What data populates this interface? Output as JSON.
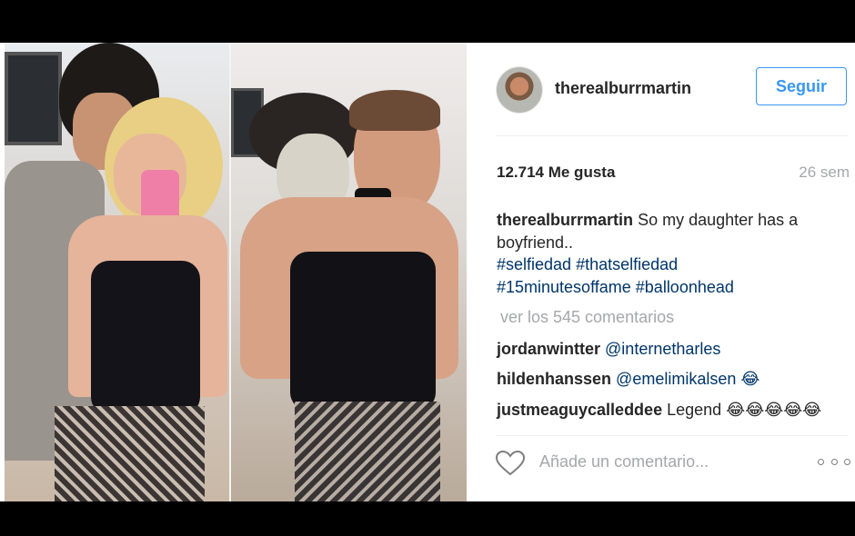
{
  "post": {
    "username": "therealburrmartin",
    "follow_label": "Seguir",
    "likes": "12.714 Me gusta",
    "time_ago": "26 sem",
    "caption": {
      "username": "therealburrmartin",
      "text": "So my daughter has a boyfriend..",
      "hashtags": [
        "#selfiedad",
        "#thatselfiedad",
        "#15minutesoffame",
        "#balloonhead"
      ]
    },
    "view_comments": "ver los 545 comentarios",
    "comments": [
      {
        "user": "jordanwintter",
        "text": "@internetharles",
        "is_mention": true
      },
      {
        "user": "hildenhanssen",
        "text": "@emelimikalsen 😂",
        "is_mention": true
      },
      {
        "user": "justmeaguycalleddee",
        "text": "Legend 😂😂😂😂😂",
        "is_mention": false
      }
    ],
    "add_comment_placeholder": "Añade un comentario...",
    "icons": {
      "like": "heart-icon",
      "options": "more-options-icon"
    }
  },
  "colors": {
    "accent": "#3897f0",
    "hashtag": "#003569",
    "muted": "#a5a7aa",
    "text": "#262626"
  }
}
